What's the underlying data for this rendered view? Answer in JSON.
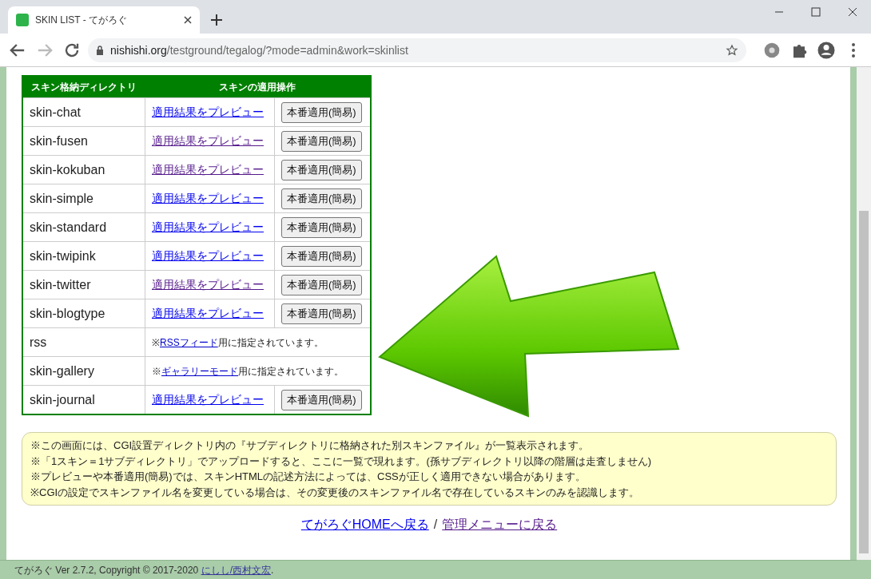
{
  "browser": {
    "tab_title": "SKIN LIST - てがろぐ",
    "address": {
      "domain": "nishishi.org",
      "path": "/testground/tegalog/?mode=admin&work=skinlist"
    }
  },
  "table": {
    "columns": [
      "スキン格納ディレクトリ",
      "スキンの適用操作"
    ],
    "rows": [
      {
        "kind": "action",
        "directory": "skin-chat",
        "preview_link": "適用結果をプレビュー",
        "visited": false,
        "apply_button": "本番適用(簡易)"
      },
      {
        "kind": "action",
        "directory": "skin-fusen",
        "preview_link": "適用結果をプレビュー",
        "visited": true,
        "apply_button": "本番適用(簡易)"
      },
      {
        "kind": "action",
        "directory": "skin-kokuban",
        "preview_link": "適用結果をプレビュー",
        "visited": true,
        "apply_button": "本番適用(簡易)"
      },
      {
        "kind": "action",
        "directory": "skin-simple",
        "preview_link": "適用結果をプレビュー",
        "visited": false,
        "apply_button": "本番適用(簡易)"
      },
      {
        "kind": "action",
        "directory": "skin-standard",
        "preview_link": "適用結果をプレビュー",
        "visited": false,
        "apply_button": "本番適用(簡易)"
      },
      {
        "kind": "action",
        "directory": "skin-twipink",
        "preview_link": "適用結果をプレビュー",
        "visited": false,
        "apply_button": "本番適用(簡易)"
      },
      {
        "kind": "action",
        "directory": "skin-twitter",
        "preview_link": "適用結果をプレビュー",
        "visited": true,
        "apply_button": "本番適用(簡易)"
      },
      {
        "kind": "action",
        "directory": "skin-blogtype",
        "preview_link": "適用結果をプレビュー",
        "visited": false,
        "apply_button": "本番適用(簡易)"
      },
      {
        "kind": "note",
        "directory": "rss",
        "note_prefix": "※",
        "note_link": "RSSフィード",
        "note_suffix": "用に指定されています。"
      },
      {
        "kind": "note",
        "directory": "skin-gallery",
        "note_prefix": "※",
        "note_link": "ギャラリーモード",
        "note_suffix": "用に指定されています。"
      },
      {
        "kind": "action",
        "directory": "skin-journal",
        "preview_link": "適用結果をプレビュー",
        "visited": false,
        "apply_button": "本番適用(簡易)"
      }
    ]
  },
  "notes": [
    "※この画面には、CGI設置ディレクトリ内の『サブディレクトリに格納された別スキンファイル』が一覧表示されます。",
    "※「1スキン＝1サブディレクトリ」でアップロードすると、ここに一覧で現れます。(孫サブディレクトリ以降の階層は走査しません)",
    "※プレビューや本番適用(簡易)では、スキンHTMLの記述方法によっては、CSSが正しく適用できない場合があります。",
    "※CGIの設定でスキンファイル名を変更している場合は、その変更後のスキンファイル名で存在しているスキンのみを認識します。"
  ],
  "nav_links": [
    {
      "label": "てがろぐHOMEへ戻る",
      "visited": false
    },
    {
      "label": "管理メニューに戻る",
      "visited": true
    }
  ],
  "nav_separator": "/",
  "footer": {
    "text": "てがろぐ Ver 2.7.2, Copyright © 2017-2020 ",
    "link": "にしし/西村文宏",
    "suffix": "."
  }
}
